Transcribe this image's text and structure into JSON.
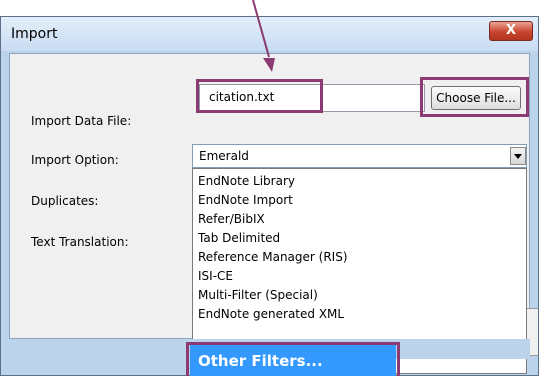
{
  "window": {
    "title": "Import",
    "close_glyph": "X"
  },
  "form": {
    "import_data_file_label": "Import Data File:",
    "import_data_file_value": "citation.txt",
    "choose_file_label": "Choose File...",
    "import_option_label": "Import Option:",
    "import_option_selected": "Emerald",
    "duplicates_label": "Duplicates:",
    "text_translation_label": "Text Translation:"
  },
  "dropdown": {
    "options": [
      "EndNote Library",
      "EndNote Import",
      "Refer/BibIX",
      "Tab Delimited",
      "Reference Manager (RIS)",
      "ISI-CE",
      "Multi-Filter (Special)",
      "EndNote generated XML"
    ],
    "highlighted_option": "Other Filters..."
  },
  "colors": {
    "highlight_box": "#8b3a72",
    "selection_blue": "#3399ff",
    "titlebar": "#c9dcf2"
  },
  "icons": [
    "close-icon",
    "chevron-down-icon",
    "annotation-arrow"
  ]
}
